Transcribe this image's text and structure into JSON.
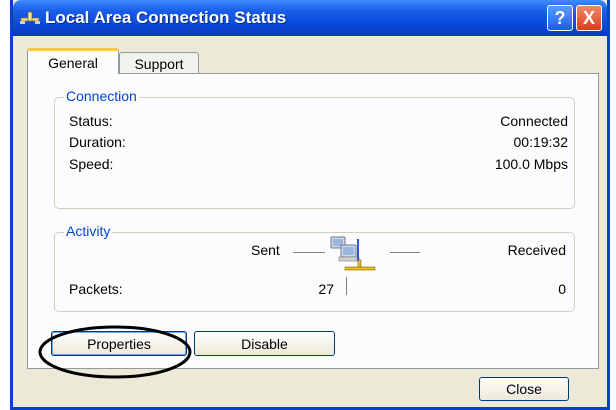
{
  "window": {
    "title": "Local Area Connection Status",
    "help_label": "?",
    "close_glyph": "X"
  },
  "tabs": [
    {
      "label": "General",
      "active": true
    },
    {
      "label": "Support",
      "active": false
    }
  ],
  "connection": {
    "group_label": "Connection",
    "rows": [
      {
        "label": "Status:",
        "value": "Connected"
      },
      {
        "label": "Duration:",
        "value": "00:19:32"
      },
      {
        "label": "Speed:",
        "value": "100.0 Mbps"
      }
    ]
  },
  "activity": {
    "group_label": "Activity",
    "sent_label": "Sent",
    "received_label": "Received",
    "packets_label": "Packets:",
    "sent_packets": "27",
    "received_packets": "0",
    "icon": "network-activity-icon"
  },
  "buttons": {
    "properties": "Properties",
    "disable": "Disable",
    "close": "Close"
  },
  "colors": {
    "title_bar": "#0a48d8",
    "group_label": "#0046d5",
    "active_tab_highlight": "#ffc83c",
    "dialog_bg": "#ece9d8"
  }
}
